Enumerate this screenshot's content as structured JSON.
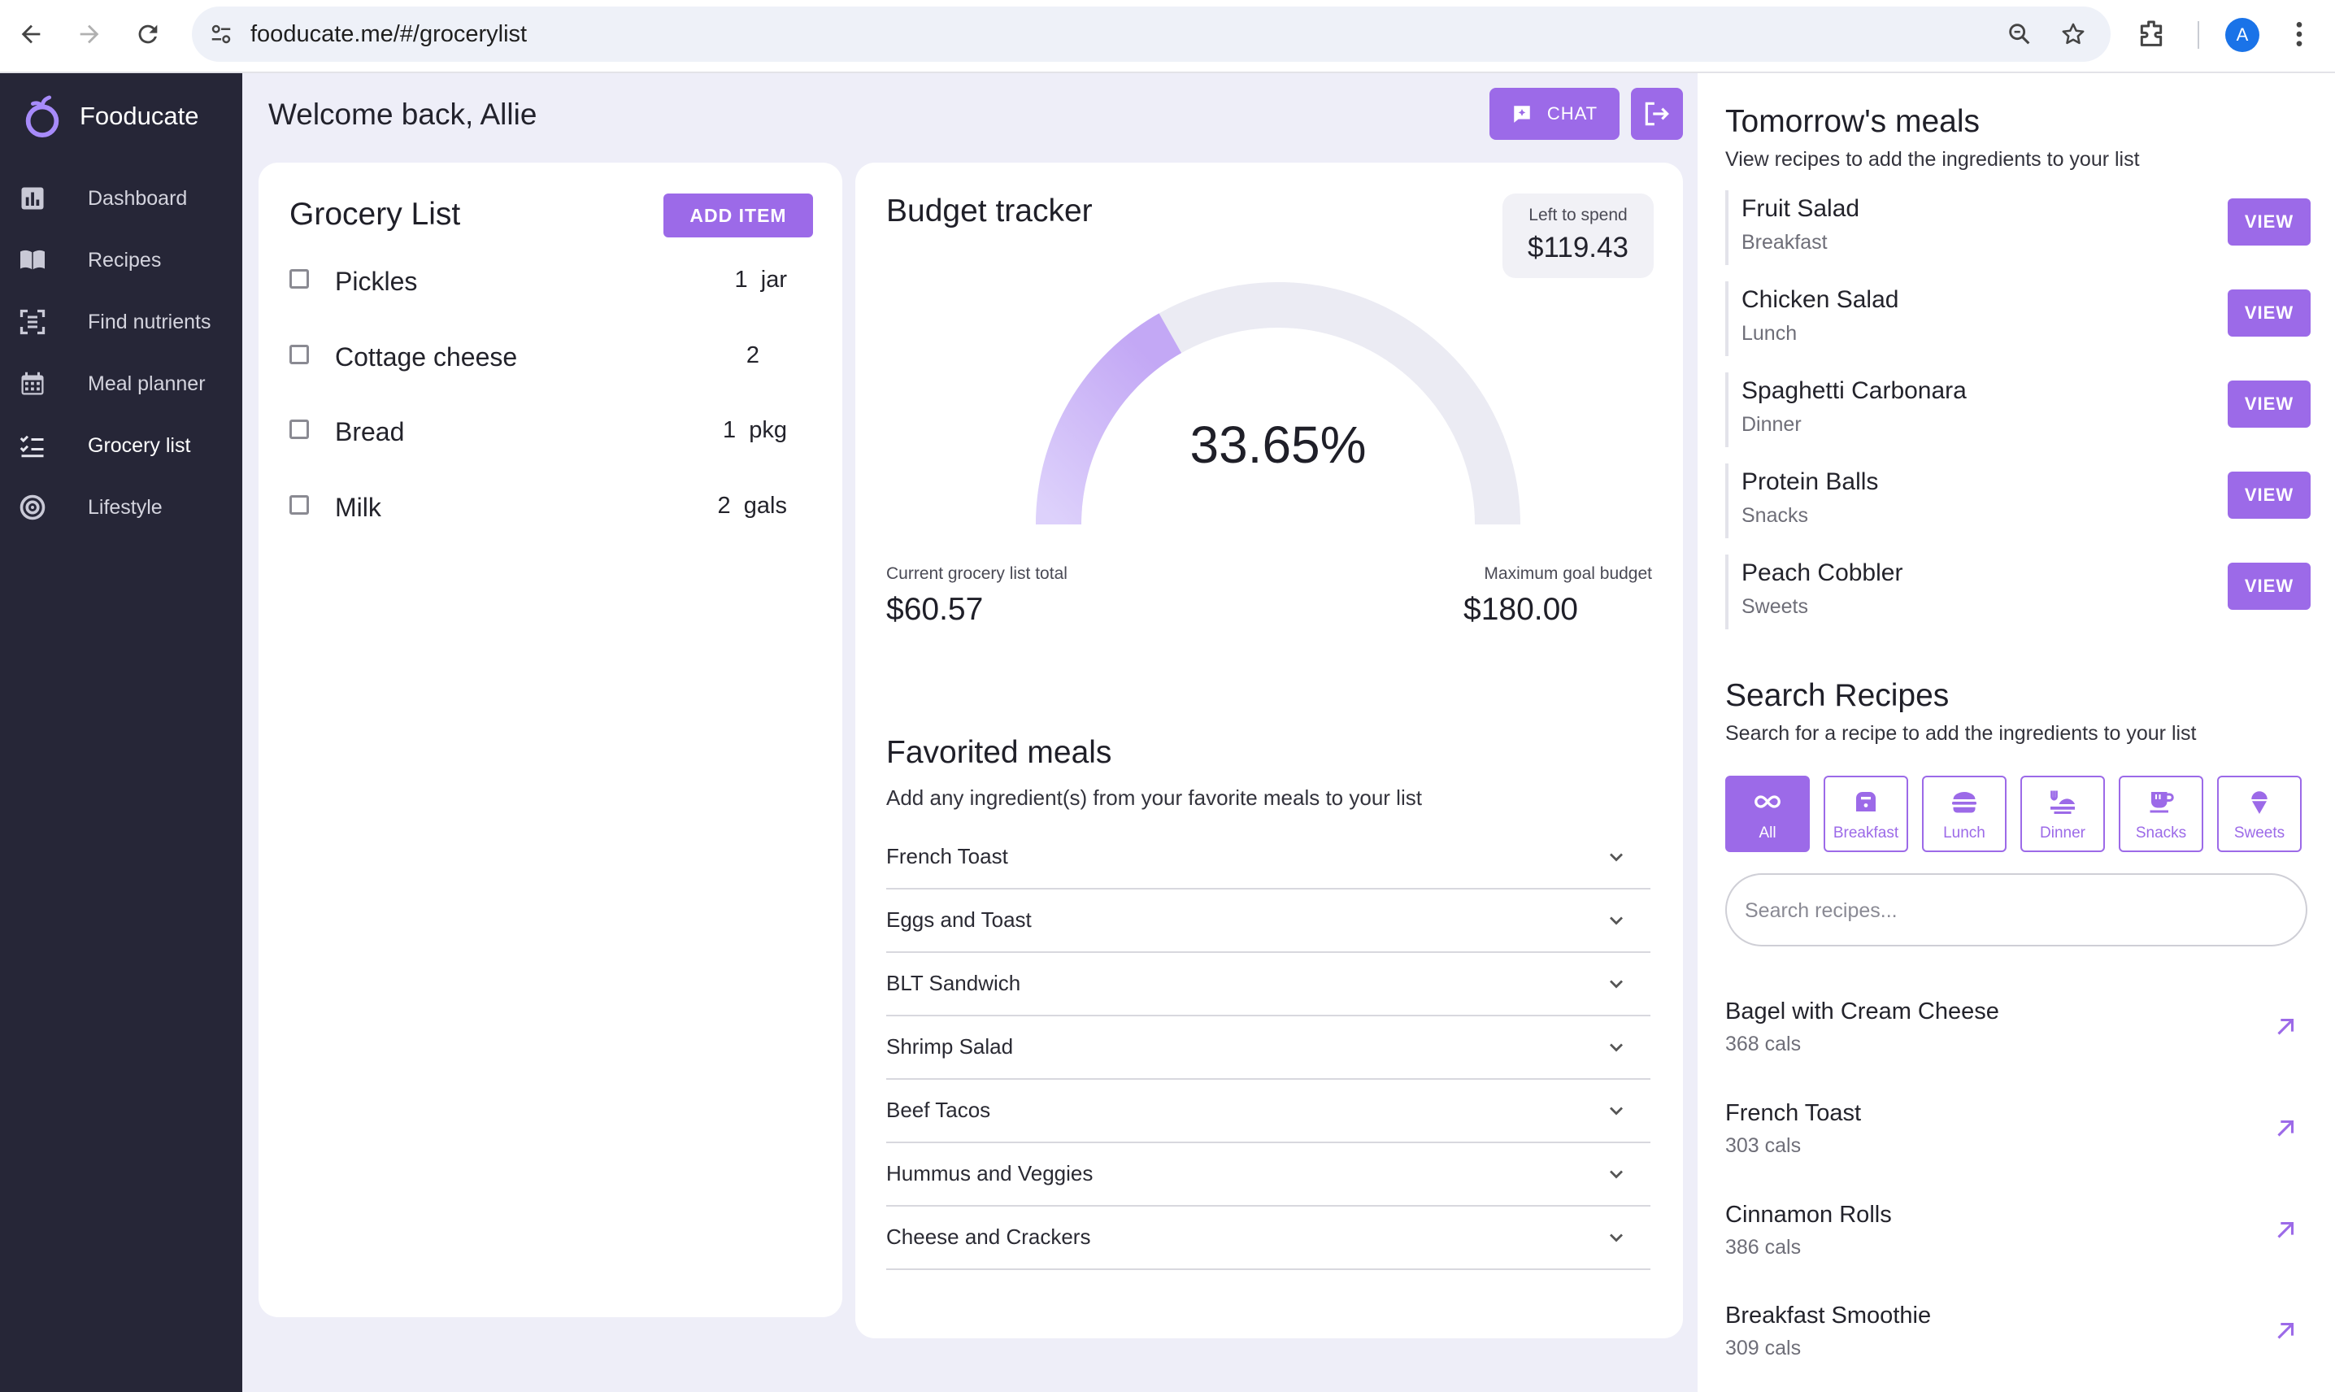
{
  "browser": {
    "url": "fooducate.me/#/grocerylist",
    "profile_initial": "A"
  },
  "app": {
    "name": "Fooducate",
    "accent_color": "#9c6ae8",
    "sidebar_color": "#262637"
  },
  "sidebar": {
    "items": [
      {
        "label": "Dashboard",
        "icon": "bar-chart-icon"
      },
      {
        "label": "Recipes",
        "icon": "book-icon"
      },
      {
        "label": "Find nutrients",
        "icon": "scan-icon"
      },
      {
        "label": "Meal planner",
        "icon": "calendar-icon"
      },
      {
        "label": "Grocery list",
        "icon": "checklist-icon",
        "active": true
      },
      {
        "label": "Lifestyle",
        "icon": "target-icon"
      }
    ]
  },
  "header": {
    "welcome": "Welcome back, Allie",
    "chat_label": "CHAT"
  },
  "grocery": {
    "title": "Grocery List",
    "add_label": "ADD ITEM",
    "items": [
      {
        "name": "Pickles",
        "qty": "1  jar",
        "checked": false
      },
      {
        "name": "Cottage cheese",
        "qty": "2",
        "checked": false
      },
      {
        "name": "Bread",
        "qty": "1  pkg",
        "checked": false
      },
      {
        "name": "Milk",
        "qty": "2  gals",
        "checked": false
      }
    ]
  },
  "budget": {
    "title": "Budget tracker",
    "left_label": "Left to spend",
    "left_value": "$119.43",
    "percent_text": "33.65%",
    "percent": 33.65,
    "current_label": "Current grocery list total",
    "current_value": "$60.57",
    "max_label": "Maximum goal budget",
    "max_value": "$180.00"
  },
  "favorites": {
    "title": "Favorited meals",
    "subtitle": "Add any ingredient(s) from your favorite meals to your list",
    "meals": [
      "French Toast",
      "Eggs and Toast",
      "BLT Sandwich",
      "Shrimp Salad",
      "Beef Tacos",
      "Hummus and Veggies",
      "Cheese and Crackers"
    ]
  },
  "tomorrow": {
    "title": "Tomorrow's meals",
    "subtitle": "View recipes to add the ingredients to your list",
    "view_label": "VIEW",
    "meals": [
      {
        "name": "Fruit Salad",
        "type": "Breakfast"
      },
      {
        "name": "Chicken Salad",
        "type": "Lunch"
      },
      {
        "name": "Spaghetti Carbonara",
        "type": "Dinner"
      },
      {
        "name": "Protein Balls",
        "type": "Snacks"
      },
      {
        "name": "Peach Cobbler",
        "type": "Sweets"
      }
    ]
  },
  "search": {
    "title": "Search Recipes",
    "subtitle": "Search for a recipe to add the ingredients to your list",
    "placeholder": "Search recipes...",
    "filters": [
      {
        "label": "All",
        "icon": "infinity-icon",
        "active": true
      },
      {
        "label": "Breakfast",
        "icon": "toaster-icon"
      },
      {
        "label": "Lunch",
        "icon": "burger-icon"
      },
      {
        "label": "Dinner",
        "icon": "dinner-icon"
      },
      {
        "label": "Snacks",
        "icon": "cup-icon"
      },
      {
        "label": "Sweets",
        "icon": "ice-cream-icon"
      }
    ],
    "results": [
      {
        "name": "Bagel with Cream Cheese",
        "cals": "368 cals"
      },
      {
        "name": "French Toast",
        "cals": "303 cals"
      },
      {
        "name": "Cinnamon Rolls",
        "cals": "386 cals"
      },
      {
        "name": "Breakfast Smoothie",
        "cals": "309 cals"
      }
    ]
  }
}
